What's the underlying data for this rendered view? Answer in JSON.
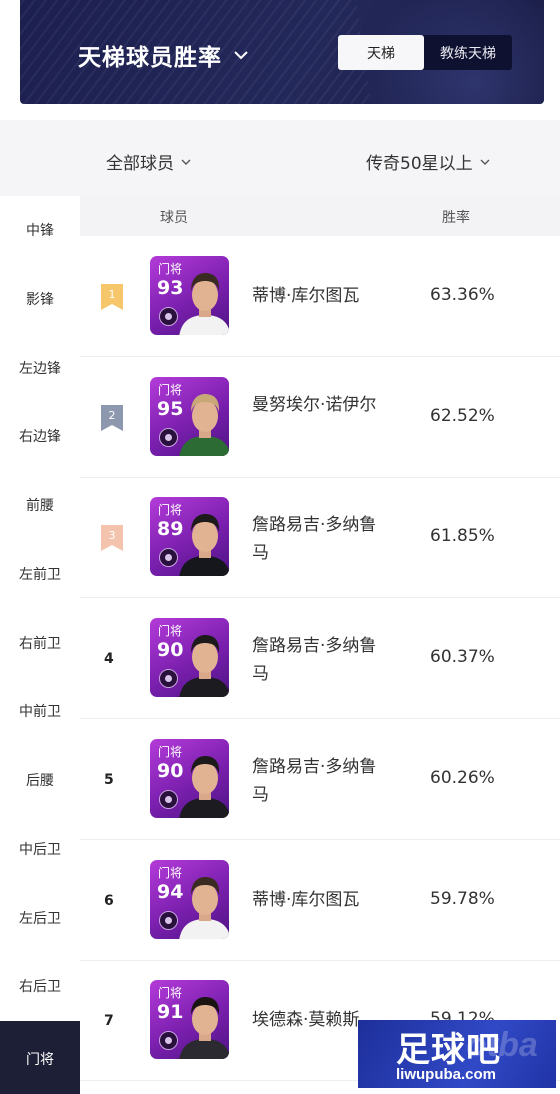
{
  "header": {
    "title": "天梯球员胜率",
    "tabs": [
      {
        "label": "天梯",
        "active": true
      },
      {
        "label": "教练天梯",
        "active": false
      }
    ]
  },
  "filters": {
    "scope": "全部球员",
    "tier": "传奇50星以上"
  },
  "sidebar": {
    "items": [
      {
        "label": "中锋",
        "active": false
      },
      {
        "label": "影锋",
        "active": false
      },
      {
        "label": "左边锋",
        "active": false
      },
      {
        "label": "右边锋",
        "active": false
      },
      {
        "label": "前腰",
        "active": false
      },
      {
        "label": "左前卫",
        "active": false
      },
      {
        "label": "右前卫",
        "active": false
      },
      {
        "label": "中前卫",
        "active": false
      },
      {
        "label": "后腰",
        "active": false
      },
      {
        "label": "中后卫",
        "active": false
      },
      {
        "label": "左后卫",
        "active": false
      },
      {
        "label": "右后卫",
        "active": false
      },
      {
        "label": "门将",
        "active": true
      }
    ]
  },
  "table": {
    "headers": {
      "player": "球员",
      "rate": "胜率"
    },
    "rows": [
      {
        "rank": "1",
        "position": "门将",
        "rating": "93",
        "name": "蒂博·库尔图瓦",
        "rate": "63.36%"
      },
      {
        "rank": "2",
        "position": "门将",
        "rating": "95",
        "name": "曼努埃尔·诺伊尔",
        "rate": "62.52%"
      },
      {
        "rank": "3",
        "position": "门将",
        "rating": "89",
        "name": "詹路易吉·多纳鲁马",
        "rate": "61.85%"
      },
      {
        "rank": "4",
        "position": "门将",
        "rating": "90",
        "name": "詹路易吉·多纳鲁马",
        "rate": "60.37%"
      },
      {
        "rank": "5",
        "position": "门将",
        "rating": "90",
        "name": "詹路易吉·多纳鲁马",
        "rate": "60.26%"
      },
      {
        "rank": "6",
        "position": "门将",
        "rating": "94",
        "name": "蒂博·库尔图瓦",
        "rate": "59.78%"
      },
      {
        "rank": "7",
        "position": "门将",
        "rating": "91",
        "name": "埃德森·莫赖斯",
        "rate": "59.12%"
      }
    ]
  },
  "medal_colors": {
    "gold": "#f5c66a",
    "silver": "#8d97ad",
    "bronze": "#f4c3ad"
  },
  "watermark": {
    "title": "足球吧",
    "url": "liwupuba.com",
    "bg_text": "otba"
  }
}
